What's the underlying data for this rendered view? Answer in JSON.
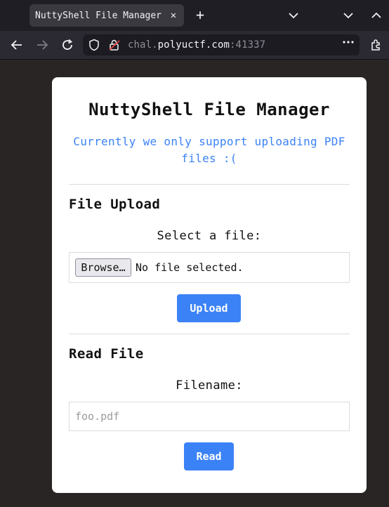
{
  "browser": {
    "tab_title": "NuttyShell File Manager",
    "url_scheme_prefix": "chal.",
    "url_host": "polyuctf.com",
    "url_port": ":41337"
  },
  "page": {
    "title": "NuttyShell File Manager",
    "subtitle": "Currently we only support uploading PDF files :(",
    "upload": {
      "heading": "File Upload",
      "select_label": "Select a file:",
      "browse_label": "Browse…",
      "no_file_text": "No file selected.",
      "upload_button": "Upload"
    },
    "read": {
      "heading": "Read File",
      "filename_label": "Filename:",
      "filename_placeholder": "foo.pdf",
      "read_button": "Read"
    }
  },
  "colors": {
    "accent": "#3b82f6",
    "page_bg": "#2a2525"
  }
}
